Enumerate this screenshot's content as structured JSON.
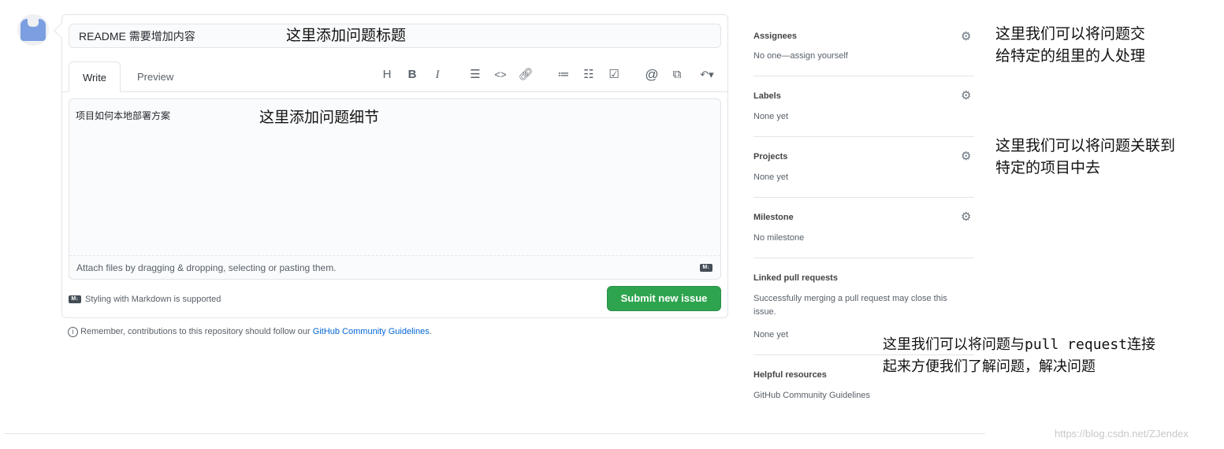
{
  "issue_form": {
    "title_value": "README 需要增加内容",
    "tabs": [
      {
        "label": "Write",
        "active": true
      },
      {
        "label": "Preview",
        "active": false
      }
    ],
    "toolbar": [
      "heading-icon",
      "bold-icon",
      "italic-icon",
      "quote-icon",
      "code-icon",
      "link-icon",
      "unordered-list-icon",
      "ordered-list-icon",
      "task-list-icon",
      "mention-icon",
      "reference-icon",
      "reply-icon"
    ],
    "body_value": "项目如何本地部署方案",
    "attach_hint": "Attach files by dragging & dropping, selecting or pasting them.",
    "markdown_note": "Styling with Markdown is supported",
    "submit_label": "Submit new issue",
    "remember_text": "Remember, contributions to this repository should follow our",
    "remember_link": "GitHub Community Guidelines",
    "remember_end": "."
  },
  "sidebar": {
    "assignees": {
      "title": "Assignees",
      "value": "No one—assign yourself"
    },
    "labels": {
      "title": "Labels",
      "value": "None yet"
    },
    "projects": {
      "title": "Projects",
      "value": "None yet"
    },
    "milestone": {
      "title": "Milestone",
      "value": "No milestone"
    },
    "linked": {
      "title": "Linked pull requests",
      "desc": "Successfully merging a pull request may close this issue.",
      "value": "None yet"
    },
    "helpful": {
      "title": "Helpful resources",
      "link": "GitHub Community Guidelines"
    }
  },
  "annotations": {
    "title_note": "这里添加问题标题",
    "body_note": "这里添加问题细节",
    "assignee_note_1": "这里我们可以将问题交",
    "assignee_note_2": "给特定的组里的人处理",
    "project_note_1": "这里我们可以将问题关联到",
    "project_note_2": "特定的项目中去",
    "pr_note_1": "这里我们可以将问题与pull request连接",
    "pr_note_2": "起来方便我们了解问题，解决问题"
  },
  "watermark": "https://blog.csdn.net/ZJendex",
  "colors": {
    "submit": "#2ea44f",
    "link": "#0366d6"
  }
}
